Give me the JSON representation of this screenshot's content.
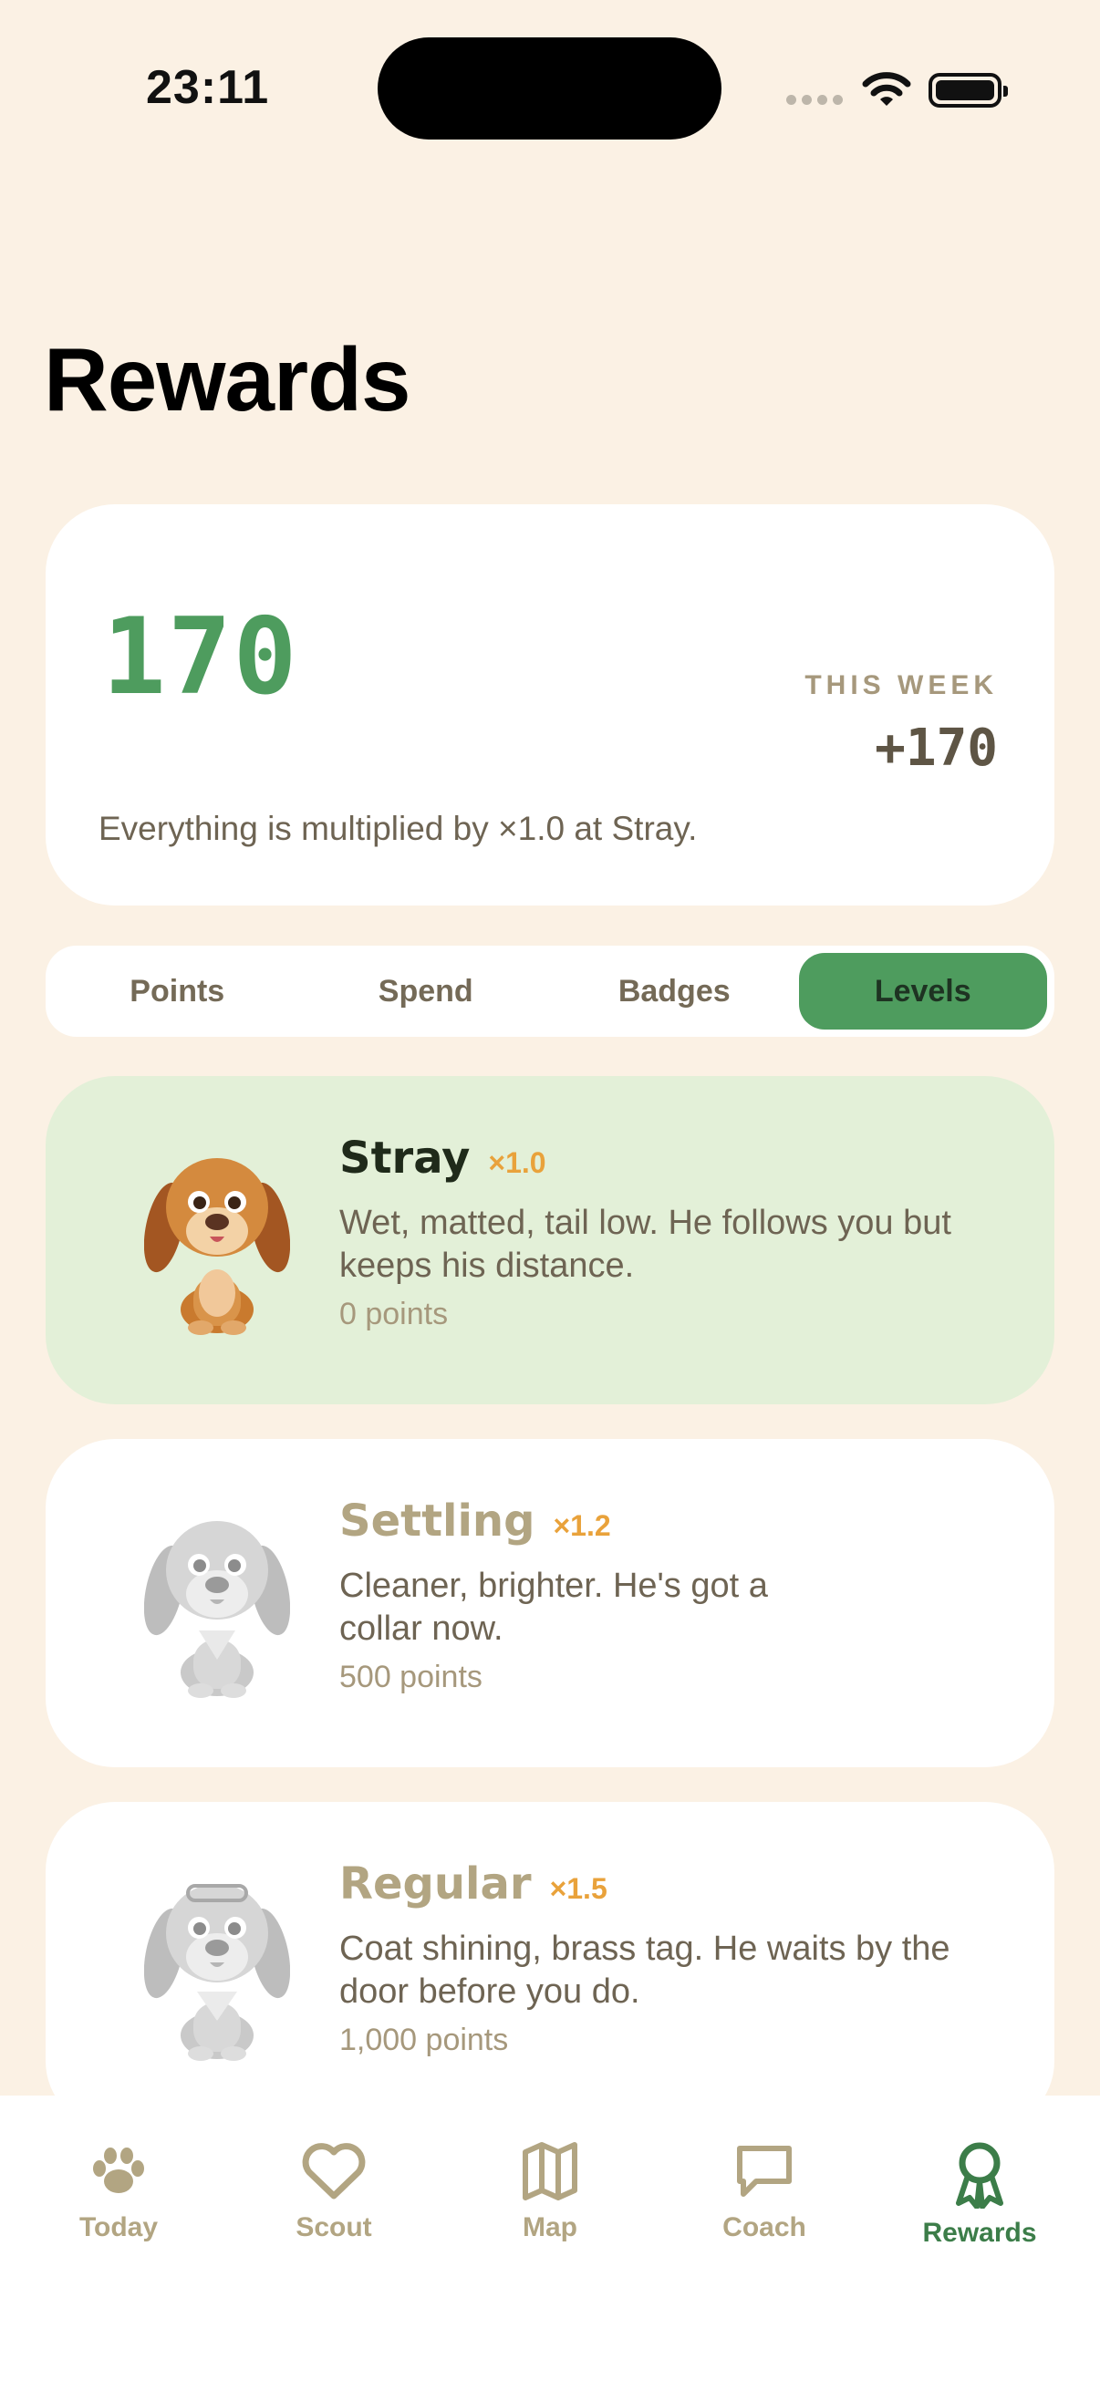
{
  "status_bar": {
    "time": "23:11"
  },
  "page": {
    "title": "Rewards"
  },
  "summary": {
    "total_points": "170",
    "week_label": "THIS WEEK",
    "week_value": "+170",
    "note": "Everything is multiplied by ×1.0 at Stray."
  },
  "tabs": [
    "Points",
    "Spend",
    "Badges",
    "Levels"
  ],
  "active_tab": "Levels",
  "levels": [
    {
      "name": "Stray",
      "multiplier": "×1.0",
      "description": "Wet, matted, tail low. He follows you but keeps his distance.",
      "requirement": "0 points",
      "current": true
    },
    {
      "name": "Settling",
      "multiplier": "×1.2",
      "description": "Cleaner, brighter. He's got a collar now.",
      "requirement": "500 points",
      "current": false
    },
    {
      "name": "Regular",
      "multiplier": "×1.5",
      "description": "Coat shining, brass tag. He waits by the door before you do.",
      "requirement": "1,000 points",
      "current": false
    }
  ],
  "tabbar": [
    {
      "label": "Today",
      "icon": "paw-icon"
    },
    {
      "label": "Scout",
      "icon": "heart-icon"
    },
    {
      "label": "Map",
      "icon": "map-icon"
    },
    {
      "label": "Coach",
      "icon": "chat-bubble-icon"
    },
    {
      "label": "Rewards",
      "icon": "ribbon-award-icon"
    }
  ],
  "colors": {
    "background": "#FBF1E4",
    "accent_green": "#4E9C5E",
    "current_level_bg": "#E3F0D8",
    "multiplier_orange": "#E9A23B",
    "muted_tan": "#B2A582"
  }
}
